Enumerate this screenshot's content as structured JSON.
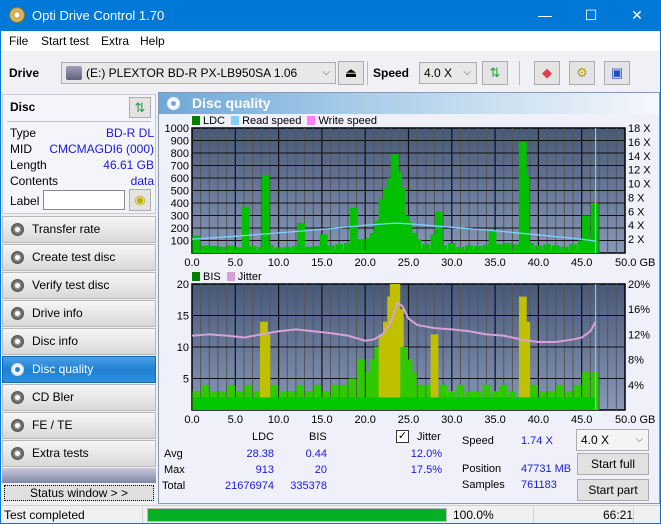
{
  "window": {
    "title": "Opti Drive Control 1.70",
    "minimize": "—",
    "maximize": "☐",
    "close": "✕"
  },
  "menu": [
    "File",
    "Start test",
    "Extra",
    "Help"
  ],
  "toolbar": {
    "drive_label": "Drive",
    "drive_value": "(E:)  PLEXTOR BD-R  PX-LB950SA 1.06",
    "speed_label": "Speed",
    "speed_value": "4.0 X"
  },
  "disc": {
    "header": "Disc",
    "rows": [
      {
        "label": "Type",
        "value": "BD-R DL"
      },
      {
        "label": "MID",
        "value": "CMCMAGDI6 (000)"
      },
      {
        "label": "Length",
        "value": "46.61 GB"
      },
      {
        "label": "Contents",
        "value": "data"
      }
    ],
    "label_field_label": "Label",
    "label_field_value": ""
  },
  "nav": [
    {
      "label": "Transfer rate",
      "active": false
    },
    {
      "label": "Create test disc",
      "active": false
    },
    {
      "label": "Verify test disc",
      "active": false
    },
    {
      "label": "Drive info",
      "active": false
    },
    {
      "label": "Disc info",
      "active": false
    },
    {
      "label": "Disc quality",
      "active": true
    },
    {
      "label": "CD Bler",
      "active": false
    },
    {
      "label": "FE / TE",
      "active": false
    },
    {
      "label": "Extra tests",
      "active": false
    }
  ],
  "status_window_button": "Status window > >",
  "main": {
    "title": "Disc quality"
  },
  "chart_data": [
    {
      "type": "bar",
      "title": "LDC / Read speed",
      "legend": [
        {
          "name": "LDC",
          "color": "#008000"
        },
        {
          "name": "Read speed",
          "color": "#7fcfff"
        },
        {
          "name": "Write speed",
          "color": "#ff80ff"
        }
      ],
      "xlabel": "GB",
      "x_ticks": [
        "0.0",
        "5.0",
        "10.0",
        "15.0",
        "20.0",
        "25.0",
        "30.0",
        "35.0",
        "40.0",
        "45.0",
        "50.0 GB"
      ],
      "xlim": [
        0,
        50
      ],
      "y_ticks_left": [
        "100",
        "200",
        "300",
        "400",
        "500",
        "600",
        "700",
        "800",
        "900",
        "1000"
      ],
      "ylim_left": [
        0,
        1000
      ],
      "y_ticks_right": [
        "2 X",
        "4 X",
        "6 X",
        "8 X",
        "10 X",
        "12 X",
        "14 X",
        "16 X",
        "18 X"
      ],
      "ylim_right": [
        0,
        18
      ],
      "series": [
        {
          "name": "LDC",
          "x": [
            0.5,
            1.5,
            2.5,
            3.5,
            4.5,
            5.5,
            6.2,
            7.0,
            8.0,
            8.5,
            9.0,
            10.0,
            11.0,
            12.0,
            12.6,
            13.5,
            14.5,
            15.2,
            16.0,
            17.0,
            18.0,
            18.7,
            19.5,
            20.5,
            21.0,
            21.5,
            22.0,
            22.5,
            23.0,
            23.4,
            23.8,
            24.2,
            24.6,
            25.0,
            25.5,
            26.0,
            27.0,
            28.0,
            28.5,
            29.0,
            30.0,
            31.0,
            32.0,
            33.0,
            34.0,
            34.7,
            35.5,
            36.5,
            37.5,
            38.2,
            38.5,
            39.0,
            40.0,
            41.0,
            42.0,
            43.0,
            44.0,
            45.0,
            45.5,
            46.0,
            46.5
          ],
          "values": [
            140,
            60,
            55,
            50,
            60,
            45,
            370,
            55,
            50,
            620,
            60,
            45,
            50,
            55,
            240,
            50,
            55,
            150,
            60,
            70,
            80,
            360,
            110,
            120,
            160,
            260,
            430,
            520,
            600,
            790,
            650,
            520,
            300,
            250,
            160,
            110,
            70,
            150,
            330,
            60,
            80,
            50,
            60,
            55,
            65,
            180,
            70,
            80,
            70,
            890,
            620,
            80,
            60,
            70,
            60,
            50,
            70,
            100,
            300,
            120,
            400
          ]
        },
        {
          "name": "Read speed",
          "x": [
            0,
            5,
            10,
            15,
            20,
            23.5,
            25,
            30,
            35,
            40,
            45,
            46.6
          ],
          "values": [
            2.0,
            2.4,
            2.9,
            3.4,
            4.0,
            4.3,
            4.2,
            3.7,
            3.2,
            2.6,
            2.0,
            1.7
          ]
        }
      ]
    },
    {
      "type": "bar",
      "title": "BIS / Jitter",
      "legend": [
        {
          "name": "BIS",
          "color": "#008000"
        },
        {
          "name": "Jitter",
          "color": "#d8a0d8"
        }
      ],
      "xlabel": "GB",
      "x_ticks": [
        "0.0",
        "5.0",
        "10.0",
        "15.0",
        "20.0",
        "25.0",
        "30.0",
        "35.0",
        "40.0",
        "45.0",
        "50.0 GB"
      ],
      "xlim": [
        0,
        50
      ],
      "y_ticks_left": [
        "5",
        "10",
        "15",
        "20"
      ],
      "ylim_left": [
        0,
        20
      ],
      "y_ticks_right": [
        "4%",
        "8%",
        "12%",
        "16%",
        "20%"
      ],
      "ylim_right": [
        0,
        20
      ],
      "series": [
        {
          "name": "BIS",
          "x": [
            0.5,
            1.5,
            2.5,
            3.5,
            4.5,
            5.5,
            6.5,
            7.5,
            8.3,
            8.6,
            9.5,
            10.5,
            11.5,
            12.5,
            13.5,
            14.5,
            15.5,
            16.5,
            17.5,
            18.5,
            19.5,
            20.5,
            21.0,
            21.5,
            22.0,
            22.5,
            23.0,
            23.3,
            23.6,
            24.0,
            24.5,
            25.0,
            25.5,
            26.5,
            27.5,
            28.0,
            29.0,
            30.0,
            31.0,
            32.0,
            33.0,
            34.0,
            35.0,
            36.0,
            37.0,
            38.2,
            38.6,
            39.5,
            40.5,
            41.5,
            42.5,
            43.5,
            44.5,
            45.5,
            46.5
          ],
          "values": [
            3,
            4,
            3,
            3,
            4,
            3,
            4,
            3,
            14,
            12,
            4,
            3,
            3,
            4,
            3,
            4,
            3,
            4,
            4,
            5,
            8,
            6,
            8,
            10,
            12,
            14,
            18,
            20,
            20,
            16,
            10,
            8,
            6,
            4,
            4,
            12,
            4,
            3,
            4,
            3,
            3,
            4,
            3,
            4,
            3,
            18,
            14,
            4,
            3,
            3,
            4,
            3,
            4,
            6,
            6
          ]
        },
        {
          "name": "Jitter",
          "x": [
            0,
            2,
            4,
            6,
            8,
            10,
            12,
            14,
            16,
            18,
            20,
            21,
            22,
            23,
            23.7,
            24.3,
            25,
            26,
            28,
            30,
            32,
            34,
            36,
            38,
            40,
            42,
            44,
            45,
            46,
            46.6
          ],
          "values": [
            11.8,
            12.0,
            11.8,
            11.5,
            12.0,
            12.5,
            12.8,
            12.5,
            12.2,
            11.8,
            11.0,
            11.2,
            12.0,
            14.0,
            17.0,
            16.5,
            14.5,
            13.5,
            13.0,
            12.8,
            12.5,
            12.0,
            11.8,
            11.2,
            10.8,
            10.8,
            11.2,
            11.5,
            12.5,
            14.0
          ]
        }
      ]
    }
  ],
  "stats": {
    "col_ldc": "LDC",
    "col_bis": "BIS",
    "jitter_label": "Jitter",
    "jitter_checked": true,
    "rows": [
      {
        "label": "Avg",
        "ldc": "28.38",
        "bis": "0.44",
        "jitter": "12.0%"
      },
      {
        "label": "Max",
        "ldc": "913",
        "bis": "20",
        "jitter": "17.5%"
      },
      {
        "label": "Total",
        "ldc": "21676974",
        "bis": "335378",
        "jitter": ""
      }
    ],
    "speed_label": "Speed",
    "speed_value": "1.74 X",
    "position_label": "Position",
    "position_value": "47731 MB",
    "samples_label": "Samples",
    "samples_value": "761183",
    "speed_select": "4.0 X",
    "start_full": "Start full",
    "start_part": "Start part"
  },
  "statusbar": {
    "text": "Test completed",
    "progress_percent": 100,
    "progress_text": "100.0%",
    "time": "66:21"
  }
}
